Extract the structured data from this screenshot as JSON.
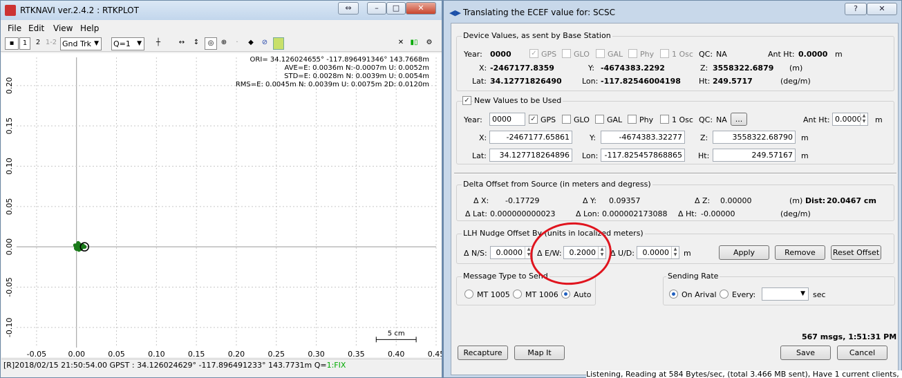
{
  "plot_window": {
    "title": "RTKNAVI ver.2.4.2 : RTKPLOT",
    "menu": [
      "File",
      "Edit",
      "View",
      "Help"
    ],
    "toolbar": {
      "btn1": "1",
      "btn2": "2",
      "btn3": "1-2",
      "plot_type": "Gnd Trk",
      "quality": "Q=1"
    },
    "stats": [
      "ORI= 34.126024655° -117.896491346° 143.7668m",
      "AVE=E: 0.0036m N:-0.0007m U: 0.0052m",
      "STD=E: 0.0028m N: 0.0039m U: 0.0054m",
      "RMS=E: 0.0045m N: 0.0039m U: 0.0075m 2D: 0.0120m"
    ],
    "scale_label": "5 cm",
    "status_prefix": "[R]2018/02/15 21:50:54.00 GPST :  34.126024629° -117.896491233°  143.7731m  Q=",
    "status_fix": "1:FIX"
  },
  "chart_data": {
    "type": "scatter",
    "title": "",
    "xlabel": "",
    "ylabel": "",
    "xlim": [
      -0.075,
      0.45
    ],
    "ylim": [
      -0.125,
      0.235
    ],
    "x_ticks": [
      "-0.05",
      "0.00",
      "0.05",
      "0.10",
      "0.15",
      "0.20",
      "0.25",
      "0.30",
      "0.35",
      "0.40",
      "0.45"
    ],
    "y_ticks": [
      "0.20",
      "0.15",
      "0.10",
      "0.05",
      "0.00",
      "-0.05",
      "-0.10"
    ],
    "x_tick_values": [
      -0.05,
      0,
      0.05,
      0.1,
      0.15,
      0.2,
      0.25,
      0.3,
      0.35,
      0.4,
      0.45
    ],
    "y_tick_values": [
      0.2,
      0.15,
      0.1,
      0.05,
      0.0,
      -0.05,
      -0.1
    ],
    "series": [
      {
        "points": [
          [
            0.003,
            0.001
          ],
          [
            0.002,
            -0.002
          ],
          [
            0.005,
            0.002
          ],
          [
            -0.001,
            0.0
          ],
          [
            0.004,
            -0.001
          ],
          [
            0.006,
            0.001
          ],
          [
            0.001,
            0.003
          ],
          [
            0.0,
            -0.003
          ],
          [
            0.003,
            0.004
          ],
          [
            0.007,
            -0.001
          ],
          [
            -0.002,
            0.002
          ],
          [
            0.002,
            0.0
          ],
          [
            0.004,
            0.003
          ],
          [
            0.005,
            -0.003
          ],
          [
            0.001,
            -0.001
          ],
          [
            0.008,
            0.002
          ],
          [
            0.002,
            0.005
          ],
          [
            0.006,
            -0.002
          ],
          [
            -0.001,
            -0.002
          ],
          [
            0.003,
            -0.004
          ]
        ]
      }
    ],
    "grid": true,
    "colors": {
      "points": "#1a7a1a",
      "current": "#000000",
      "grid": "#c8c8c8"
    }
  },
  "dialog": {
    "title": "Translating the ECEF value for: SCSC",
    "help": "?",
    "close": "X",
    "device": {
      "label": "Device Values, as sent by Base Station",
      "year_label": "Year:",
      "year": "0000",
      "gps": "GPS",
      "glo": "GLO",
      "gal": "GAL",
      "phy": "Phy",
      "osc": "1 Osc",
      "qc_label": "QC:",
      "qc": "NA",
      "antht_label": "Ant Ht:",
      "antht": "0.0000",
      "antht_unit": "m",
      "x_label": "X:",
      "x": "-2467177.8359",
      "y_label": "Y:",
      "y": "-4674383.2292",
      "z_label": "Z:",
      "z": "3558322.6879",
      "xyz_unit": "(m)",
      "lat_label": "Lat:",
      "lat": "34.12771826490",
      "lon_label": "Lon:",
      "lon": "-117.82546004198",
      "ht_label": "Ht:",
      "ht": "249.5717",
      "llh_unit": "(deg/m)"
    },
    "newvals": {
      "label": "New Values to be Used",
      "year_label": "Year:",
      "year": "0000",
      "gps": "GPS",
      "glo": "GLO",
      "gal": "GAL",
      "phy": "Phy",
      "osc": "1 Osc",
      "qc_label": "QC:",
      "qc": "NA",
      "qc_btn": "...",
      "antht_label": "Ant Ht:",
      "antht": "0.0000",
      "antht_unit": "m",
      "x_label": "X:",
      "x": "-2467177.65861",
      "y_label": "Y:",
      "y": "-4674383.32277",
      "z_label": "Z:",
      "z": "3558322.68790",
      "xyz_unit": "m",
      "lat_label": "Lat:",
      "lat": "34.127718264896",
      "lon_label": "Lon:",
      "lon": "-117.825457868865",
      "ht_label": "Ht:",
      "ht": "249.57167",
      "llh_unit": "m"
    },
    "delta": {
      "label": "Delta Offset from Source (in meters and degress)",
      "dx_label": "Δ X:",
      "dx": "-0.17729",
      "dy_label": "Δ Y:",
      "dy": "0.09357",
      "dz_label": "Δ Z:",
      "dz": "0.00000",
      "xyz_unit": "(m)",
      "dist_label": "Dist:",
      "dist": "20.0467 cm",
      "dlat_label": "Δ Lat:",
      "dlat": "0.000000000023",
      "dlon_label": "Δ Lon:",
      "dlon": "0.000002173088",
      "dht_label": "Δ Ht:",
      "dht": "-0.00000",
      "llh_unit": "(deg/m)"
    },
    "nudge": {
      "label": "LLH Nudge Offset By   (units in localized meters)",
      "ns_label": "Δ N/S:",
      "ns": "0.0000",
      "ew_label": "Δ E/W:",
      "ew": "0.2000",
      "ud_label": "Δ U/D:",
      "ud": "0.0000",
      "unit": "m",
      "apply": "Apply",
      "remove": "Remove",
      "reset": "Reset Offset"
    },
    "msgtype": {
      "label": "Message Type to Send",
      "mt1005": "MT 1005",
      "mt1006": "MT 1006",
      "auto": "Auto"
    },
    "rate": {
      "label": "Sending Rate",
      "on_arrival": "On Arival",
      "every": "Every:",
      "every_value": "",
      "unit": "sec"
    },
    "footer": {
      "status": "567 msgs,  1:51:31 PM",
      "recapture": "Recapture",
      "mapit": "Map It",
      "save": "Save",
      "cancel": "Cancel"
    }
  },
  "background_text": "Listening,   Reading at 584 Bytes/sec, (total 3.466 MB sent), Have 1 current clients,"
}
